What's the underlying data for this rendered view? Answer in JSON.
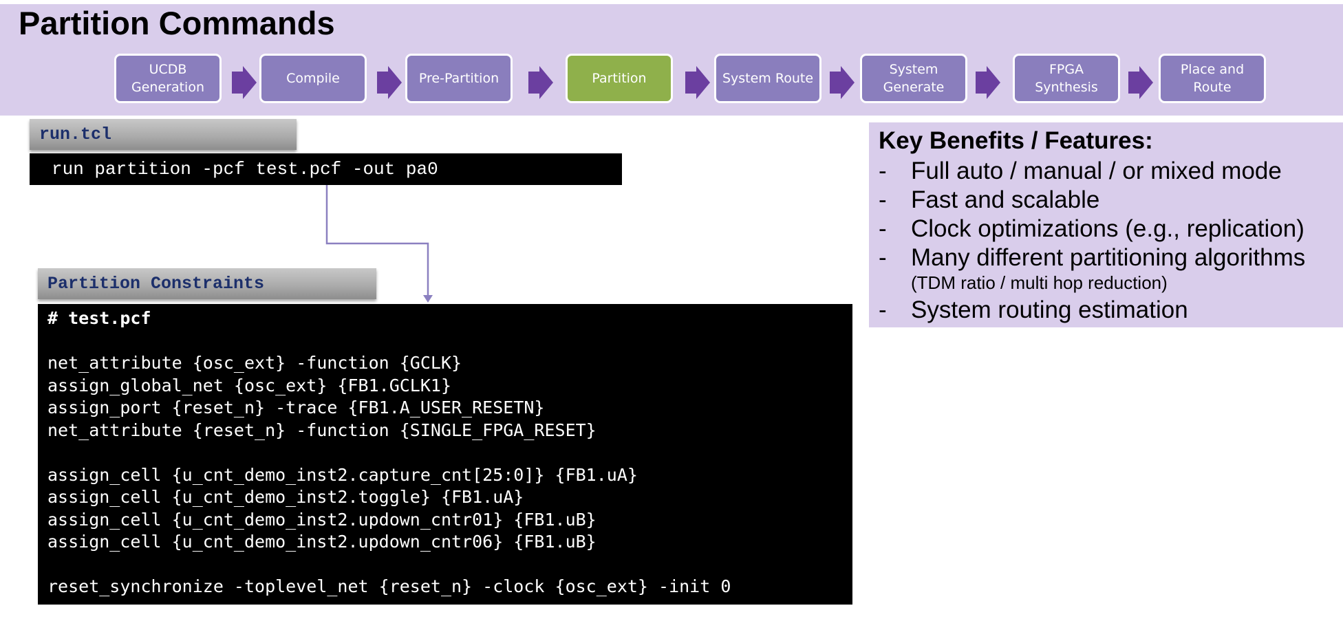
{
  "title": "Partition Commands",
  "flow": {
    "steps": [
      {
        "label": "UCDB\nGeneration",
        "active": false
      },
      {
        "label": "Compile",
        "active": false
      },
      {
        "label": "Pre-Partition",
        "active": false
      },
      {
        "label": "Partition",
        "active": true
      },
      {
        "label": "System Route",
        "active": false
      },
      {
        "label": "System\nGenerate",
        "active": false
      },
      {
        "label": "FPGA\nSynthesis",
        "active": false
      },
      {
        "label": "Place and\nRoute",
        "active": false
      }
    ]
  },
  "run_tcl": {
    "label": "run.tcl",
    "command": "run partition -pcf test.pcf -out pa0"
  },
  "constraints": {
    "label": "Partition Constraints",
    "lines": [
      "# test.pcf",
      "",
      "net_attribute {osc_ext} -function {GCLK}",
      "assign_global_net {osc_ext} {FB1.GCLK1}",
      "assign_port {reset_n} -trace {FB1.A_USER_RESETN}",
      "net_attribute {reset_n} -function {SINGLE_FPGA_RESET}",
      "",
      "assign_cell {u_cnt_demo_inst2.capture_cnt[25:0]} {FB1.uA}",
      "assign_cell {u_cnt_demo_inst2.toggle} {FB1.uA}",
      "assign_cell {u_cnt_demo_inst2.updown_cntr01} {FB1.uB}",
      "assign_cell {u_cnt_demo_inst2.updown_cntr06} {FB1.uB}",
      "",
      "reset_synchronize -toplevel_net {reset_n} -clock {osc_ext} -init 0"
    ]
  },
  "benefits": {
    "heading": "Key Benefits / Features:",
    "items": [
      {
        "text": "Full auto / manual / or mixed mode"
      },
      {
        "text": "Fast and scalable"
      },
      {
        "text": "Clock optimizations (e.g., replication)"
      },
      {
        "text": "Many different partitioning algorithms",
        "note": "(TDM ratio / multi hop reduction)"
      },
      {
        "text": "System routing estimation"
      }
    ]
  },
  "colors": {
    "band": "#d9cdeb",
    "step": "#8a7ebd",
    "step_active": "#8fb04b",
    "arrow": "#6b3fa0",
    "connector": "#8b80c0",
    "label_text": "#1c2f6b"
  }
}
